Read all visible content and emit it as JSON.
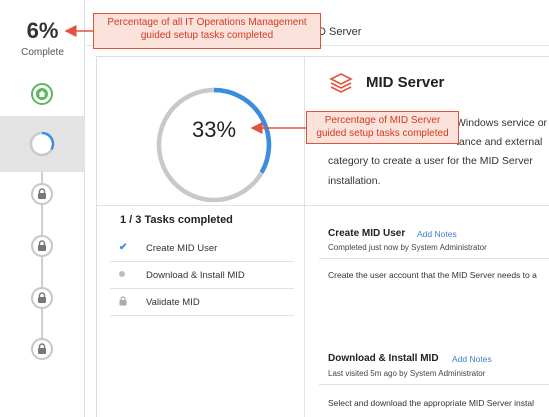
{
  "overall": {
    "percent": "6%",
    "label": "Complete"
  },
  "header": {
    "title_fragment": "D Server"
  },
  "stage": {
    "percent": "33%",
    "title": "MID Server"
  },
  "description": {
    "lines": [
      "Windows service or",
      "tance and external",
      "category to create a user for the MID Server",
      "installation."
    ]
  },
  "tasks": {
    "summary": "1 / 3 Tasks completed",
    "items": [
      {
        "label": "Create MID User",
        "status": "completed",
        "icon": "check-icon"
      },
      {
        "label": "Download & Install MID",
        "status": "pending",
        "icon": "dot-icon"
      },
      {
        "label": "Validate MID",
        "status": "locked",
        "icon": "lock-icon"
      }
    ]
  },
  "sections": [
    {
      "title": "Create MID User",
      "link": "Add Notes",
      "meta": "Completed just now by System Administrator",
      "body": "Create the user account that the MID Server needs to a"
    },
    {
      "title": "Download & Install MID",
      "link": "Add Notes",
      "meta": "Last visited 5m ago by System Administrator",
      "body": "Select and download the appropriate MID Server instal"
    }
  ],
  "callouts": {
    "overall": "Percentage of all IT Operations Management guided setup tasks completed",
    "stage": "Percentage of MID Server guided setup tasks completed"
  },
  "colors": {
    "accent": "#3b8de0",
    "success": "#5cb85c",
    "callout_border": "#e0533d",
    "callout_fill": "#fbe3dc",
    "brand_icon": "#e0533d"
  }
}
